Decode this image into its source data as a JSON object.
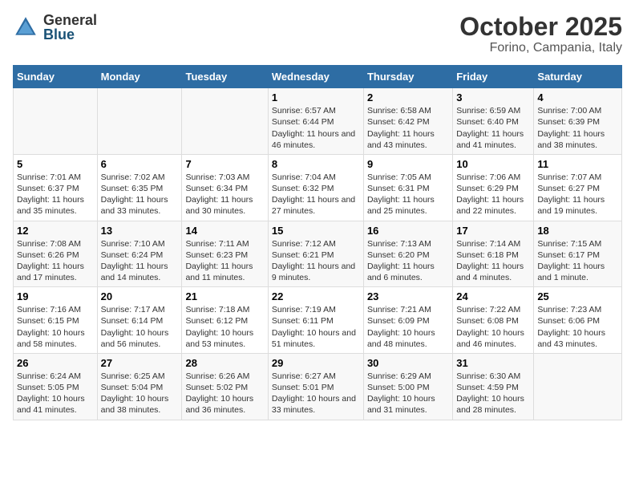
{
  "logo": {
    "general": "General",
    "blue": "Blue"
  },
  "title": "October 2025",
  "subtitle": "Forino, Campania, Italy",
  "days_of_week": [
    "Sunday",
    "Monday",
    "Tuesday",
    "Wednesday",
    "Thursday",
    "Friday",
    "Saturday"
  ],
  "weeks": [
    [
      {
        "day": "",
        "info": ""
      },
      {
        "day": "",
        "info": ""
      },
      {
        "day": "",
        "info": ""
      },
      {
        "day": "1",
        "info": "Sunrise: 6:57 AM\nSunset: 6:44 PM\nDaylight: 11 hours and 46 minutes."
      },
      {
        "day": "2",
        "info": "Sunrise: 6:58 AM\nSunset: 6:42 PM\nDaylight: 11 hours and 43 minutes."
      },
      {
        "day": "3",
        "info": "Sunrise: 6:59 AM\nSunset: 6:40 PM\nDaylight: 11 hours and 41 minutes."
      },
      {
        "day": "4",
        "info": "Sunrise: 7:00 AM\nSunset: 6:39 PM\nDaylight: 11 hours and 38 minutes."
      }
    ],
    [
      {
        "day": "5",
        "info": "Sunrise: 7:01 AM\nSunset: 6:37 PM\nDaylight: 11 hours and 35 minutes."
      },
      {
        "day": "6",
        "info": "Sunrise: 7:02 AM\nSunset: 6:35 PM\nDaylight: 11 hours and 33 minutes."
      },
      {
        "day": "7",
        "info": "Sunrise: 7:03 AM\nSunset: 6:34 PM\nDaylight: 11 hours and 30 minutes."
      },
      {
        "day": "8",
        "info": "Sunrise: 7:04 AM\nSunset: 6:32 PM\nDaylight: 11 hours and 27 minutes."
      },
      {
        "day": "9",
        "info": "Sunrise: 7:05 AM\nSunset: 6:31 PM\nDaylight: 11 hours and 25 minutes."
      },
      {
        "day": "10",
        "info": "Sunrise: 7:06 AM\nSunset: 6:29 PM\nDaylight: 11 hours and 22 minutes."
      },
      {
        "day": "11",
        "info": "Sunrise: 7:07 AM\nSunset: 6:27 PM\nDaylight: 11 hours and 19 minutes."
      }
    ],
    [
      {
        "day": "12",
        "info": "Sunrise: 7:08 AM\nSunset: 6:26 PM\nDaylight: 11 hours and 17 minutes."
      },
      {
        "day": "13",
        "info": "Sunrise: 7:10 AM\nSunset: 6:24 PM\nDaylight: 11 hours and 14 minutes."
      },
      {
        "day": "14",
        "info": "Sunrise: 7:11 AM\nSunset: 6:23 PM\nDaylight: 11 hours and 11 minutes."
      },
      {
        "day": "15",
        "info": "Sunrise: 7:12 AM\nSunset: 6:21 PM\nDaylight: 11 hours and 9 minutes."
      },
      {
        "day": "16",
        "info": "Sunrise: 7:13 AM\nSunset: 6:20 PM\nDaylight: 11 hours and 6 minutes."
      },
      {
        "day": "17",
        "info": "Sunrise: 7:14 AM\nSunset: 6:18 PM\nDaylight: 11 hours and 4 minutes."
      },
      {
        "day": "18",
        "info": "Sunrise: 7:15 AM\nSunset: 6:17 PM\nDaylight: 11 hours and 1 minute."
      }
    ],
    [
      {
        "day": "19",
        "info": "Sunrise: 7:16 AM\nSunset: 6:15 PM\nDaylight: 10 hours and 58 minutes."
      },
      {
        "day": "20",
        "info": "Sunrise: 7:17 AM\nSunset: 6:14 PM\nDaylight: 10 hours and 56 minutes."
      },
      {
        "day": "21",
        "info": "Sunrise: 7:18 AM\nSunset: 6:12 PM\nDaylight: 10 hours and 53 minutes."
      },
      {
        "day": "22",
        "info": "Sunrise: 7:19 AM\nSunset: 6:11 PM\nDaylight: 10 hours and 51 minutes."
      },
      {
        "day": "23",
        "info": "Sunrise: 7:21 AM\nSunset: 6:09 PM\nDaylight: 10 hours and 48 minutes."
      },
      {
        "day": "24",
        "info": "Sunrise: 7:22 AM\nSunset: 6:08 PM\nDaylight: 10 hours and 46 minutes."
      },
      {
        "day": "25",
        "info": "Sunrise: 7:23 AM\nSunset: 6:06 PM\nDaylight: 10 hours and 43 minutes."
      }
    ],
    [
      {
        "day": "26",
        "info": "Sunrise: 6:24 AM\nSunset: 5:05 PM\nDaylight: 10 hours and 41 minutes."
      },
      {
        "day": "27",
        "info": "Sunrise: 6:25 AM\nSunset: 5:04 PM\nDaylight: 10 hours and 38 minutes."
      },
      {
        "day": "28",
        "info": "Sunrise: 6:26 AM\nSunset: 5:02 PM\nDaylight: 10 hours and 36 minutes."
      },
      {
        "day": "29",
        "info": "Sunrise: 6:27 AM\nSunset: 5:01 PM\nDaylight: 10 hours and 33 minutes."
      },
      {
        "day": "30",
        "info": "Sunrise: 6:29 AM\nSunset: 5:00 PM\nDaylight: 10 hours and 31 minutes."
      },
      {
        "day": "31",
        "info": "Sunrise: 6:30 AM\nSunset: 4:59 PM\nDaylight: 10 hours and 28 minutes."
      },
      {
        "day": "",
        "info": ""
      }
    ]
  ]
}
